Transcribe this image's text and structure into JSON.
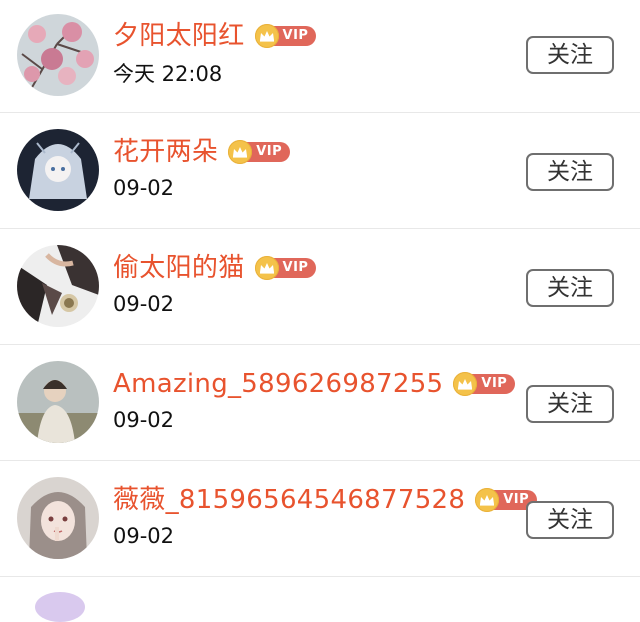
{
  "follow_label": "关注",
  "vip_label": "VIP",
  "users": [
    {
      "name": "夕阳太阳红",
      "time": "今天 22:08",
      "avatar": "cherry-blossom-avatar"
    },
    {
      "name": "花开两朵",
      "time": "09-02",
      "avatar": "anime-girl-avatar"
    },
    {
      "name": "偷太阳的猫",
      "time": "09-02",
      "avatar": "sailor-uniform-avatar"
    },
    {
      "name": "Amazing_589626987255",
      "time": "09-02",
      "avatar": "girl-landscape-avatar"
    },
    {
      "name": "薇薇_81596564546877528",
      "time": "09-02",
      "avatar": "anime-portrait-avatar"
    }
  ],
  "colors": {
    "name": "#e8532e",
    "vip_tag": "#e0675a",
    "crown": "#f4c24a"
  }
}
